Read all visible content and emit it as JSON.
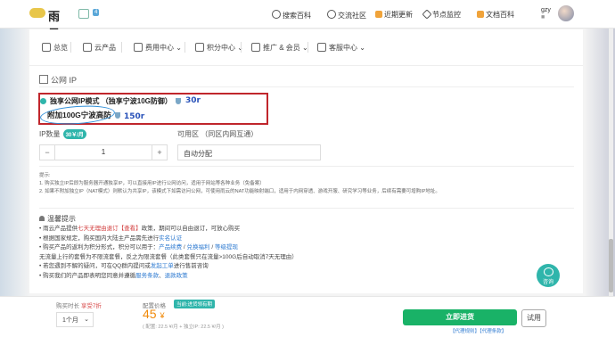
{
  "header": {
    "brand": "雨云",
    "badge": "4",
    "nav": [
      {
        "label": "搜索百科",
        "icon": "search-icon"
      },
      {
        "label": "交流社区",
        "icon": "chat-icon"
      },
      {
        "label": "近期更新",
        "icon": "calendar-icon"
      },
      {
        "label": "节点监控",
        "icon": "monitor-icon"
      },
      {
        "label": "文档百科",
        "icon": "doc-icon"
      }
    ],
    "user": "gzy",
    "user_sub": "■"
  },
  "tabs": [
    {
      "label": "总览"
    },
    {
      "label": "云产品"
    },
    {
      "label": "费用中心 ⌄"
    },
    {
      "label": "积分中心 ⌄"
    },
    {
      "label": "推广 & 会员 ⌄"
    },
    {
      "label": "客服中心 ⌄"
    }
  ],
  "section_title": "公网 IP",
  "options": {
    "primary": "独享公网IP模式 （独享宁波10G防御）",
    "primary_annotation": "30r",
    "secondary": "附加100G宁波高防",
    "secondary_annotation": "150r"
  },
  "ip_count": {
    "label": "IP数量",
    "tag": "30￥/月",
    "value": "1",
    "minus": "−",
    "plus": "+"
  },
  "zone": {
    "label": "可用区 （同区内网互通）",
    "value": "自动分配"
  },
  "notes": {
    "title": "提示:",
    "lines": [
      "1. 购买独立IP后即为服务器开通独享IP，可以直接用IP进行公网访问，适用于网站等各种业务（免备案）",
      "2. 如果不附加独立IP（NAT模式）则默认为共享IP，该模式下如需访问公网，可使用雨云的NAT功能映射端口，适用于内网穿透、游戏开服、研究学习等业务，后续有需要可增购IP地址。"
    ]
  },
  "tips": {
    "title": "温馨提示",
    "line1_a": "雨云产品提供",
    "line1_red": "七天无理由退订【查看】",
    "line1_b": "政策，期间可以自由退订，可放心购买",
    "line2_a": "根据国家规定，购买国内大陆主产品需先进行",
    "line2_link": "实名认证",
    "line3_a": "购买产品的返利为积分形式，积分可以用于：",
    "line3_link1": "产品续费",
    "line3_sep1": " / ",
    "line3_link2": "兑换福利",
    "line3_sep2": " / ",
    "line3_link3": "等级提现",
    "line4": "无流量上行的套餐为不限流套餐，反之为限流套餐（此类套餐只在流量>100G后自动取消7天无理由）",
    "line5_a": "若您遇到不解的疑问，可在QQ群内提问或",
    "line5_link": "发起工单",
    "line5_b": "进行售前咨询",
    "line6_a": "购买我们的产品即表明您同意并遵循",
    "line6_link1": "服务条款",
    "line6_sep": "、",
    "line6_link2": "退款政策"
  },
  "consult": {
    "label": "咨询"
  },
  "bottom": {
    "period_label": "购买时长",
    "period_discount": "享受7折",
    "period_value": "1个月",
    "config_label": "配置价格",
    "discount_tag": "当前:进货领有期",
    "price_currency": "¥",
    "price_value": "45",
    "price_detail": "( 配置: 22.5 ¥/月 + 独立IP: 22.5 ¥/月 )",
    "buy": "立即进货",
    "try": "试用",
    "links": "【代理规则】【代理条款】"
  }
}
